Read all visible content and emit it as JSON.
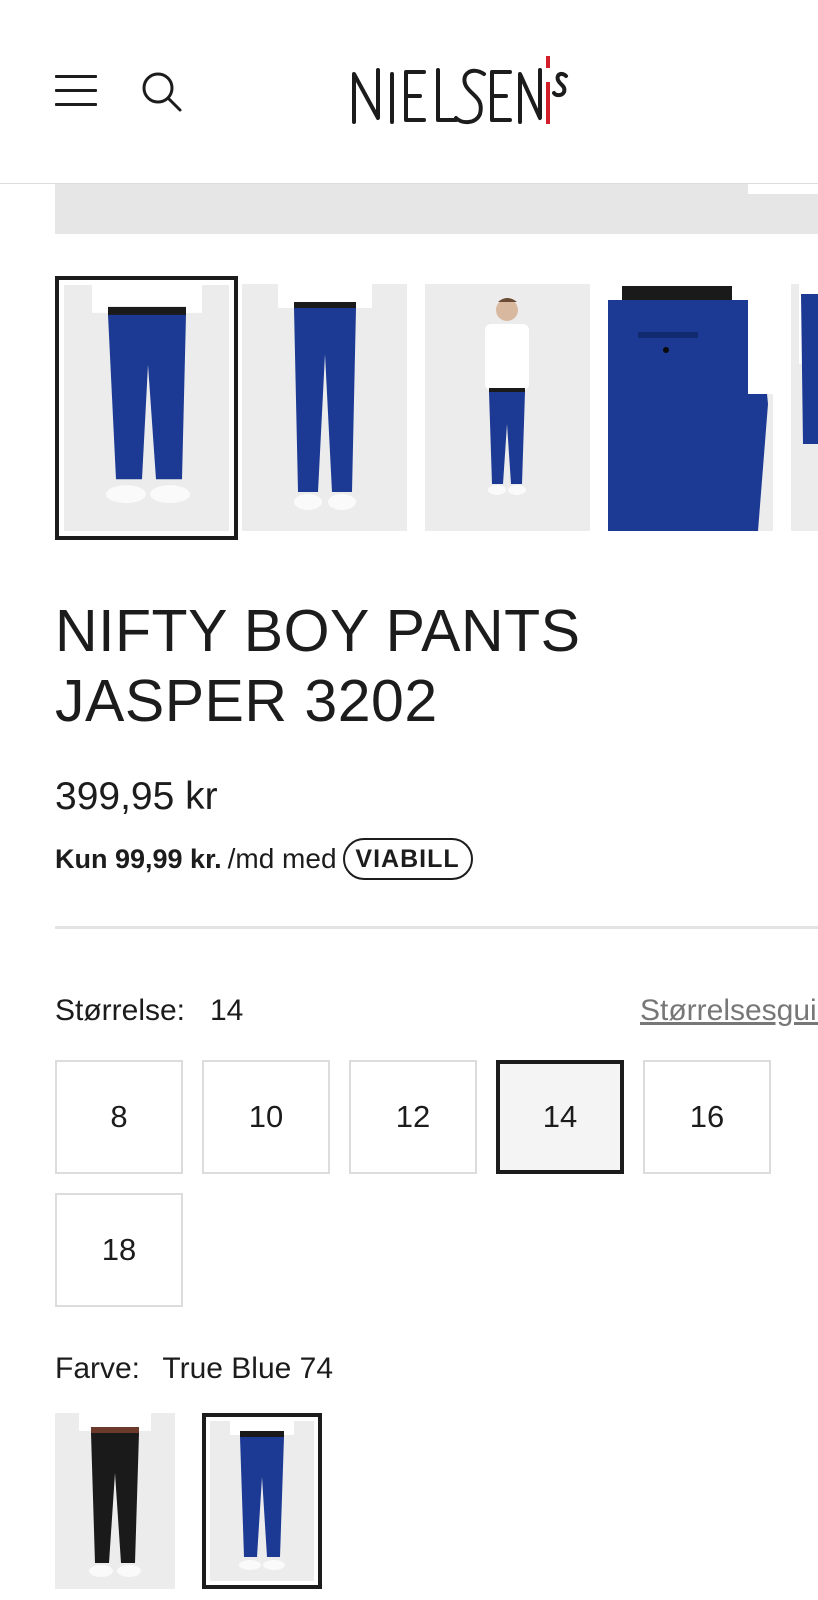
{
  "header": {
    "menu_icon": "hamburger-icon",
    "search_icon": "search-icon",
    "logo_text": "NIELSEN's"
  },
  "gallery": {
    "thumbnails": [
      {
        "name": "thumbnail-front",
        "selected": true
      },
      {
        "name": "thumbnail-back",
        "selected": false
      },
      {
        "name": "thumbnail-full-body",
        "selected": false
      },
      {
        "name": "thumbnail-pocket-detail",
        "selected": false
      },
      {
        "name": "thumbnail-side",
        "selected": false
      }
    ]
  },
  "product": {
    "title": "NIFTY BOY PANTS JASPER 3202",
    "price": "399,95 kr",
    "installment_strong": "Kun 99,99 kr.",
    "installment_suffix": "/md med",
    "installment_provider": "VIABILL"
  },
  "size": {
    "label": "Størrelse:",
    "selected_value": "14",
    "guide_label": "Størrelsesguide",
    "options": [
      "8",
      "10",
      "12",
      "14",
      "16",
      "18"
    ]
  },
  "color": {
    "label": "Farve:",
    "selected_value": "True Blue 74",
    "swatches": [
      {
        "name": "color-swatch-black",
        "color": "#1a1a1a",
        "selected": false
      },
      {
        "name": "color-swatch-true-blue",
        "color": "#1c3a94",
        "selected": true
      }
    ]
  },
  "colors": {
    "pants_blue": "#1c3a94",
    "pants_black": "#1a1a1a",
    "logo_red": "#d21f2a",
    "text": "#1c1c1c"
  }
}
